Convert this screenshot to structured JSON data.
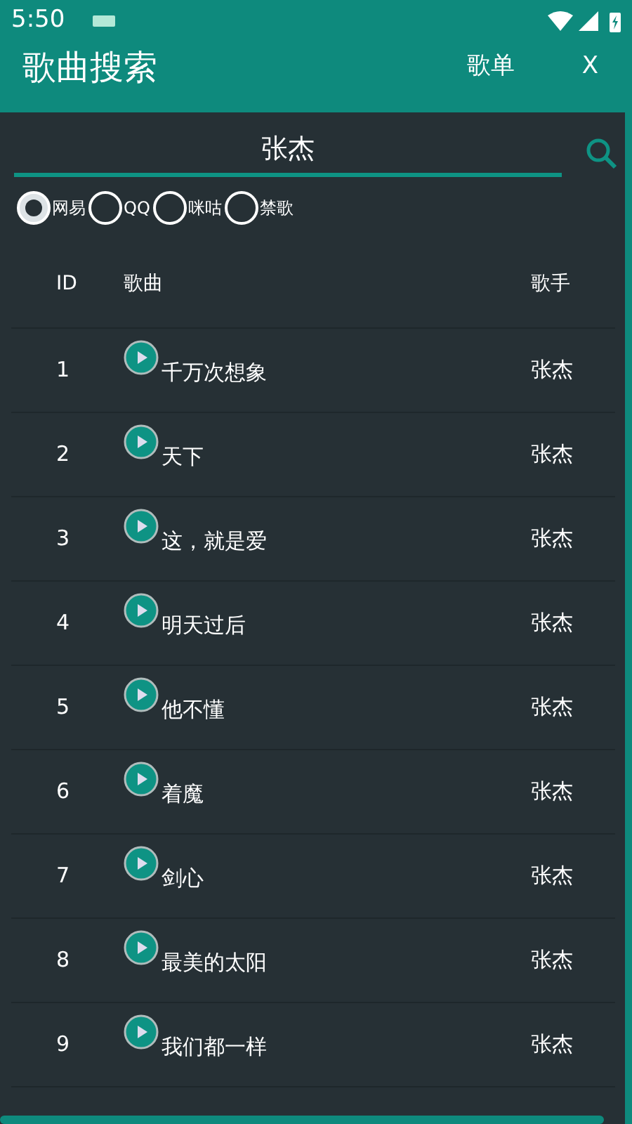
{
  "status_bar": {
    "time": "5:50"
  },
  "header": {
    "title": "歌曲搜索",
    "actions": [
      "歌单",
      "X"
    ]
  },
  "search": {
    "value": "张杰"
  },
  "sources": [
    {
      "label": "网易",
      "selected": true
    },
    {
      "label": "QQ",
      "selected": false
    },
    {
      "label": "咪咕",
      "selected": false
    },
    {
      "label": "禁歌",
      "selected": false
    }
  ],
  "table": {
    "columns": [
      "ID",
      "歌曲",
      "歌手"
    ],
    "rows": [
      {
        "id": "1",
        "song": "千万次想象",
        "artist": "张杰"
      },
      {
        "id": "2",
        "song": "天下",
        "artist": "张杰"
      },
      {
        "id": "3",
        "song": "这，就是爱",
        "artist": "张杰"
      },
      {
        "id": "4",
        "song": "明天过后",
        "artist": "张杰"
      },
      {
        "id": "5",
        "song": "他不懂",
        "artist": "张杰"
      },
      {
        "id": "6",
        "song": "着魔",
        "artist": "张杰"
      },
      {
        "id": "7",
        "song": "剑心",
        "artist": "张杰"
      },
      {
        "id": "8",
        "song": "最美的太阳",
        "artist": "张杰"
      },
      {
        "id": "9",
        "song": "我们都一样",
        "artist": "张杰"
      }
    ]
  }
}
